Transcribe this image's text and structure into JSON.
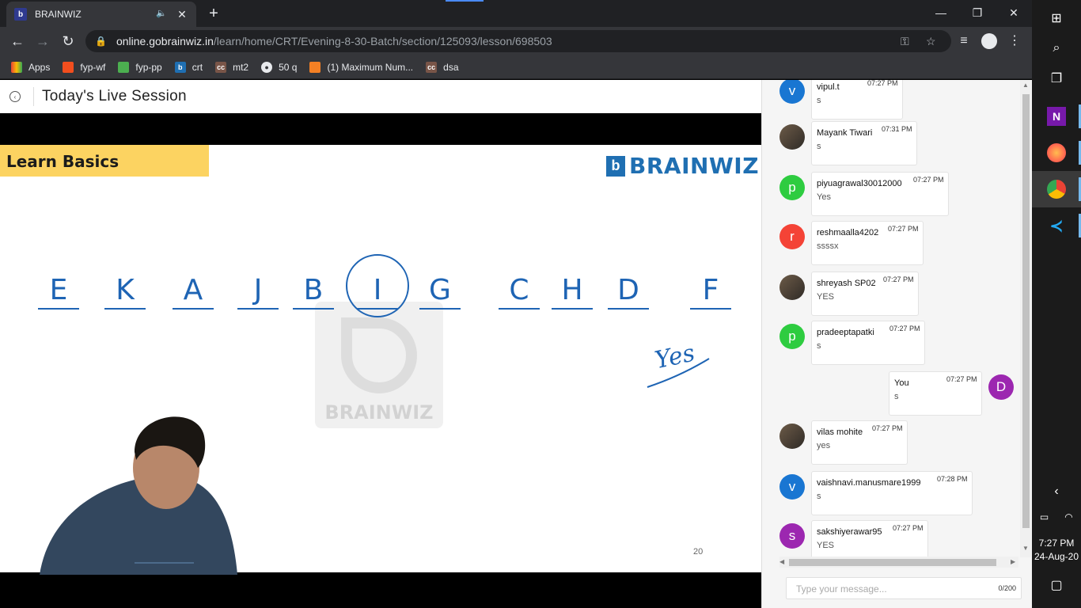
{
  "browser": {
    "tab_title": "BRAINWIZ",
    "tab_favicon": "b",
    "url_host": "online.gobrainwiz.in",
    "url_path": "/learn/home/CRT/Evening-8-30-Batch/section/125093/lesson/698503"
  },
  "bookmarks": [
    {
      "label": "Apps",
      "icon": "apps-grid-icon"
    },
    {
      "label": "fyp-wf",
      "icon": "figma-icon"
    },
    {
      "label": "fyp-pp",
      "icon": "image-icon"
    },
    {
      "label": "crt",
      "icon": "brainwiz-icon"
    },
    {
      "label": "mt2",
      "icon": "codechef-icon"
    },
    {
      "label": "50 q",
      "icon": "globe-icon"
    },
    {
      "label": "(1) Maximum Num...",
      "icon": "stackoverflow-icon"
    },
    {
      "label": "dsa",
      "icon": "codechef-icon"
    }
  ],
  "page": {
    "title": "Today's Live Session"
  },
  "slide": {
    "heading": "Learn Basics",
    "brand_mark": "b",
    "brand": "BRAINWIZ",
    "watermark": "BRAINWIZ",
    "letters": [
      "E",
      "K",
      "A",
      "J",
      "B",
      "I",
      "G",
      "C",
      "H",
      "D",
      "F"
    ],
    "circled_letter": "I",
    "handwritten_note": "Yes",
    "page_number": "20"
  },
  "chat": {
    "messages": [
      {
        "avatar_letter": "v",
        "avatar_color": "#1976d2",
        "name": "vipul.t",
        "time": "07:27 PM",
        "text": "s"
      },
      {
        "avatar_letter": "",
        "avatar_color": "#5a4a3a",
        "name": "Mayank Tiwari",
        "time": "07:31 PM",
        "text": "s"
      },
      {
        "avatar_letter": "p",
        "avatar_color": "#2ecc40",
        "name": "piyuagrawal30012000",
        "time": "07:27 PM",
        "text": "Yes"
      },
      {
        "avatar_letter": "r",
        "avatar_color": "#f44336",
        "name": "reshmaalla4202",
        "time": "07:27 PM",
        "text": "ssssx"
      },
      {
        "avatar_letter": "",
        "avatar_color": "#5a4a3a",
        "name": "shreyash SP02",
        "time": "07:27 PM",
        "text": "YES"
      },
      {
        "avatar_letter": "p",
        "avatar_color": "#2ecc40",
        "name": "pradeeptapatki",
        "time": "07:27 PM",
        "text": "s"
      },
      {
        "avatar_letter": "D",
        "avatar_color": "#9c27b0",
        "name": "You",
        "time": "07:27 PM",
        "text": "s",
        "self": true
      },
      {
        "avatar_letter": "",
        "avatar_color": "#5a4a3a",
        "name": "vilas mohite",
        "time": "07:27 PM",
        "text": "yes"
      },
      {
        "avatar_letter": "v",
        "avatar_color": "#1976d2",
        "name": "vaishnavi.manusmare1999",
        "time": "07:28 PM",
        "text": "s"
      },
      {
        "avatar_letter": "s",
        "avatar_color": "#9c27b0",
        "name": "sakshiyerawar95",
        "time": "07:27 PM",
        "text": "YES"
      }
    ],
    "input_placeholder": "Type your message...",
    "char_counter": "0/200"
  },
  "taskbar": {
    "time": "7:27 PM",
    "date": "24-Aug-20"
  }
}
